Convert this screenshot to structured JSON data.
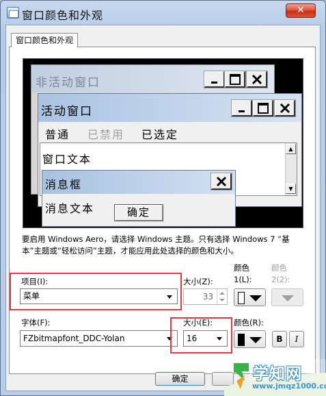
{
  "window": {
    "title": "窗口颜色和外观",
    "close_glyph": "✕"
  },
  "tab": {
    "label": "窗口颜色和外观"
  },
  "preview": {
    "inactive_title": "非活动窗口",
    "active_title": "活动窗口",
    "menu": {
      "normal": "普通",
      "disabled": "已禁用",
      "selected": "已选定"
    },
    "window_text": "窗口文本",
    "message_box_title": "消息框",
    "message_text": "消息文本",
    "ok_label": "确定",
    "scroll_up": "▲",
    "scroll_down": "▼"
  },
  "info_text": "要启用 Windows Aero，请选择 Windows 主题。只有选择 Windows 7 “基本”主题或“轻松访问”主题，才能应用此处选择的颜色和大小。",
  "item": {
    "label": "项目(I):",
    "value": "菜单"
  },
  "item_size": {
    "label": "大小(Z):",
    "value": "33"
  },
  "color1": {
    "label_line1": "颜色",
    "label_line2": "1(L):",
    "color": "#ffffff"
  },
  "color2": {
    "label_line1": "颜色",
    "label_line2": "2(2):"
  },
  "font": {
    "label": "字体(F):",
    "value": "FZbitmapfont_DDC-Yolan"
  },
  "font_size": {
    "label": "大小(E):",
    "value": "16"
  },
  "font_color": {
    "label": "颜色(R):",
    "color": "#000000"
  },
  "bold_label": "B",
  "italic_label": "I",
  "buttons": {
    "ok": "确定"
  },
  "watermark": {
    "text": "学知网",
    "url": "www.jmqz1000.com"
  },
  "colors": {
    "highlight": "#e8383f",
    "titlebar_active": "#aac3e2",
    "preview_bg": "#000000"
  }
}
